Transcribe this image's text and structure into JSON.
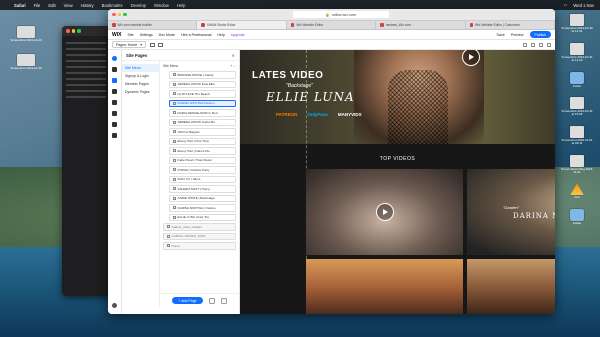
{
  "menubar": {
    "app": "Safari",
    "items": [
      "File",
      "Edit",
      "View",
      "History",
      "Bookmarks",
      "Develop",
      "Window",
      "Help"
    ],
    "clock": "Wed 1 Nov"
  },
  "browser": {
    "url": "editor.wix.com",
    "tabs": [
      {
        "label": "Wix.com website builder"
      },
      {
        "label": "SWAN Studio Editor"
      },
      {
        "label": "Wix Website Editor"
      },
      {
        "label": "hastraw_Wix.com"
      },
      {
        "label": "Wix Website Editor | Customize"
      }
    ]
  },
  "wix": {
    "logo": "WIX",
    "menu": [
      "Site",
      "Settings",
      "Dev Mode",
      "Hire a Professional",
      "Help"
    ],
    "upgrade": "Upgrade",
    "right": [
      "Save",
      "Preview"
    ],
    "publish": "Publish",
    "page_select": "Pages: Home"
  },
  "site_pages": {
    "title": "Site Pages",
    "close": "✕",
    "categories": [
      "Site Menu",
      "Signup & Login",
      "Member Pages",
      "Dynamic Pages"
    ],
    "list_header": "Site Menu",
    "list_header_right": "+ ...",
    "pages": [
      "BROWSE MOVIE | Candy",
      "SERENA WOOD Feat Elite",
      "LILITH EVE The Beach",
      "DARINA NIKITINA Passion",
      "DARIA DESCELSIOR In Red",
      "SERENA WOOD Joyful Mo..",
      "Still Fox Baguim",
      "Ebony Hart | First Time",
      "Ebony Hart | Dance Mo",
      "Katie Pavel | Hotel Room",
      "PHINIA | Outdoor Party",
      "SOFI V.K | Sluss",
      "VALERIA MATT | Horny",
      "ANNIE WHITE | Backstage",
      "DARINA NIKITINA | Outdoo",
      "ELLIE LUNA | Fast Toy",
      "Gallery_video_header",
      "CAROLL DAVIDS_SAST",
      "Home"
    ],
    "add_page": "+ Add Page"
  },
  "canvas": {
    "hero_title": "LATES VIDEO",
    "hero_sub": "\"Backstage\"",
    "hero_name": "ELLIE LUNA",
    "links": [
      "PATREON",
      "OnlyFans",
      "MANYVIDS"
    ],
    "section_title": "TOP VIDEOS",
    "video2_caption1": "\"Garden\"",
    "video2_caption2": "DARINA NIKITINA"
  },
  "desktop": {
    "right_icons": [
      "Screenshot 2023-10-30 at 12.31",
      "Screenshot 2023-10-31 at 14.20",
      "Folder",
      "Screenshot 2023-10-31 at 15.02",
      "Screenshot 2023-11-01 at 09.11",
      "Screen Recording 2023-11-01",
      "VLC",
      "Folder"
    ],
    "left_icons": [
      "Screenshot 2023-10-29",
      "Screenshot 2023-10-30"
    ]
  },
  "colors": {
    "wix_blue": "#116dff",
    "upgrade_purple": "#8a38f5",
    "patreon": "#ff7a00",
    "onlyfans": "#00aff0"
  }
}
